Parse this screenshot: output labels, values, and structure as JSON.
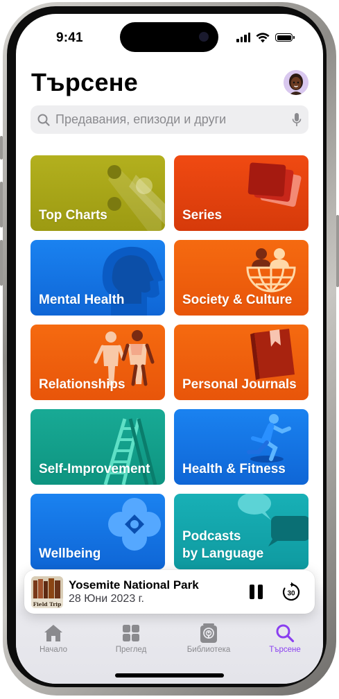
{
  "status_bar": {
    "time": "9:41"
  },
  "header": {
    "title": "Търсене"
  },
  "search": {
    "placeholder": "Предавания, епизоди и други"
  },
  "categories": [
    {
      "label": "Top Charts",
      "color": "#a8a617"
    },
    {
      "label": "Series",
      "color": "#e8410f"
    },
    {
      "label": "Mental Health",
      "color": "#1677e8"
    },
    {
      "label": "Society & Culture",
      "color": "#f2600f"
    },
    {
      "label": "Relationships",
      "color": "#f2600f"
    },
    {
      "label": "Personal Journals",
      "color": "#f2600f"
    },
    {
      "label": "Self-Improvement",
      "color": "#13a08c"
    },
    {
      "label": "Health & Fitness",
      "color": "#1677e8"
    },
    {
      "label": "Wellbeing",
      "color": "#1677e8"
    },
    {
      "label_line1": "Podcasts",
      "label_line2": "by Language",
      "color": "#15a7ad"
    }
  ],
  "now_playing": {
    "title": "Yosemite National Park",
    "subtitle": "28 Юни 2023 г.",
    "artwork_text": "Field Trip",
    "skip_seconds": "30"
  },
  "tabs": [
    {
      "label": "Начало",
      "icon": "house-icon"
    },
    {
      "label": "Преглед",
      "icon": "grid-icon"
    },
    {
      "label": "Библиотека",
      "icon": "library-icon"
    },
    {
      "label": "Търсене",
      "icon": "search-icon",
      "active": true
    }
  ],
  "colors": {
    "accent": "#8a3ff0",
    "tab_inactive": "#8a8a8e"
  }
}
